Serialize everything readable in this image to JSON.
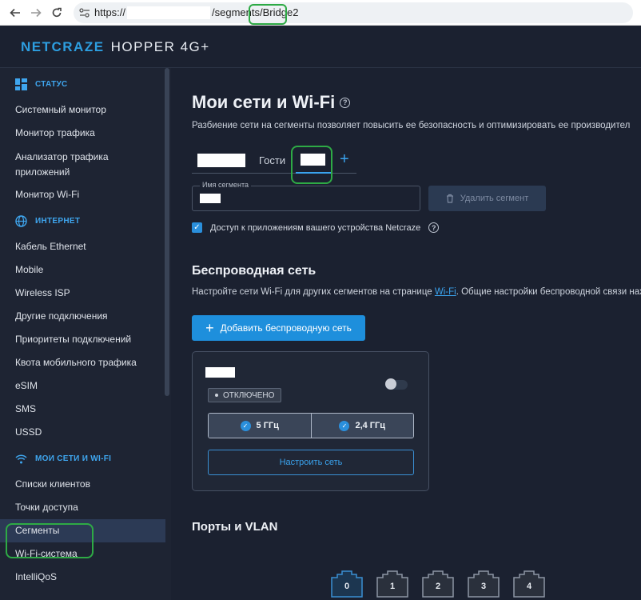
{
  "browser": {
    "url_prefix": "https://",
    "url_path": "/segments/",
    "url_highlight": "Bridge2"
  },
  "header": {
    "brand_part1": "NETCRAZE",
    "brand_part2": "HOPPER 4G+"
  },
  "sidebar": {
    "sections": [
      {
        "title": "СТАТУС",
        "icon": "dashboard-icon",
        "items": [
          "Системный монитор",
          "Монитор трафика",
          "Анализатор трафика приложений",
          "Монитор Wi-Fi"
        ]
      },
      {
        "title": "ИНТЕРНЕТ",
        "icon": "globe-icon",
        "items": [
          "Кабель Ethernet",
          "Mobile",
          "Wireless ISP",
          "Другие подключения",
          "Приоритеты подключений",
          "Квота мобильного трафика",
          "eSIM",
          "SMS",
          "USSD"
        ]
      },
      {
        "title": "МОИ СЕТИ И WI-FI",
        "icon": "wifi-icon",
        "items": [
          "Списки клиентов",
          "Точки доступа",
          "Сегменты",
          "Wi-Fi-система",
          "IntelliQoS"
        ]
      }
    ],
    "active_item": "Сегменты"
  },
  "main": {
    "title": "Мои сети и Wi-Fi",
    "description": "Разбиение сети на сегменты позволяет повысить ее безопасность и оптимизировать ее производител",
    "tabs": {
      "guest_label": "Гости",
      "add_symbol": "+"
    },
    "segment_name_label": "Имя сегмента",
    "delete_button": "Удалить сегмент",
    "app_access_label": "Доступ к приложениям вашего устройства Netcraze",
    "wireless_title": "Беспроводная сеть",
    "wireless_desc_before": "Настройте сети Wi-Fi для других сегментов на странице ",
    "wireless_desc_link": "Wi-Fi",
    "wireless_desc_after": ". Общие настройки беспроводной связи нах",
    "add_wireless_button": "Добавить беспроводную сеть",
    "card": {
      "status_badge": "ОТКЛЮЧЕНО",
      "band1": "5 ГГц",
      "band2": "2,4 ГГц",
      "setup_button": "Настроить сеть"
    },
    "ports_title": "Порты и VLAN",
    "ports": [
      "0",
      "1",
      "2",
      "3",
      "4"
    ]
  },
  "colors": {
    "accent": "#1e8fdc",
    "highlight": "#2eaa45",
    "background": "#1b2130",
    "sidebar": "#1e2433"
  }
}
